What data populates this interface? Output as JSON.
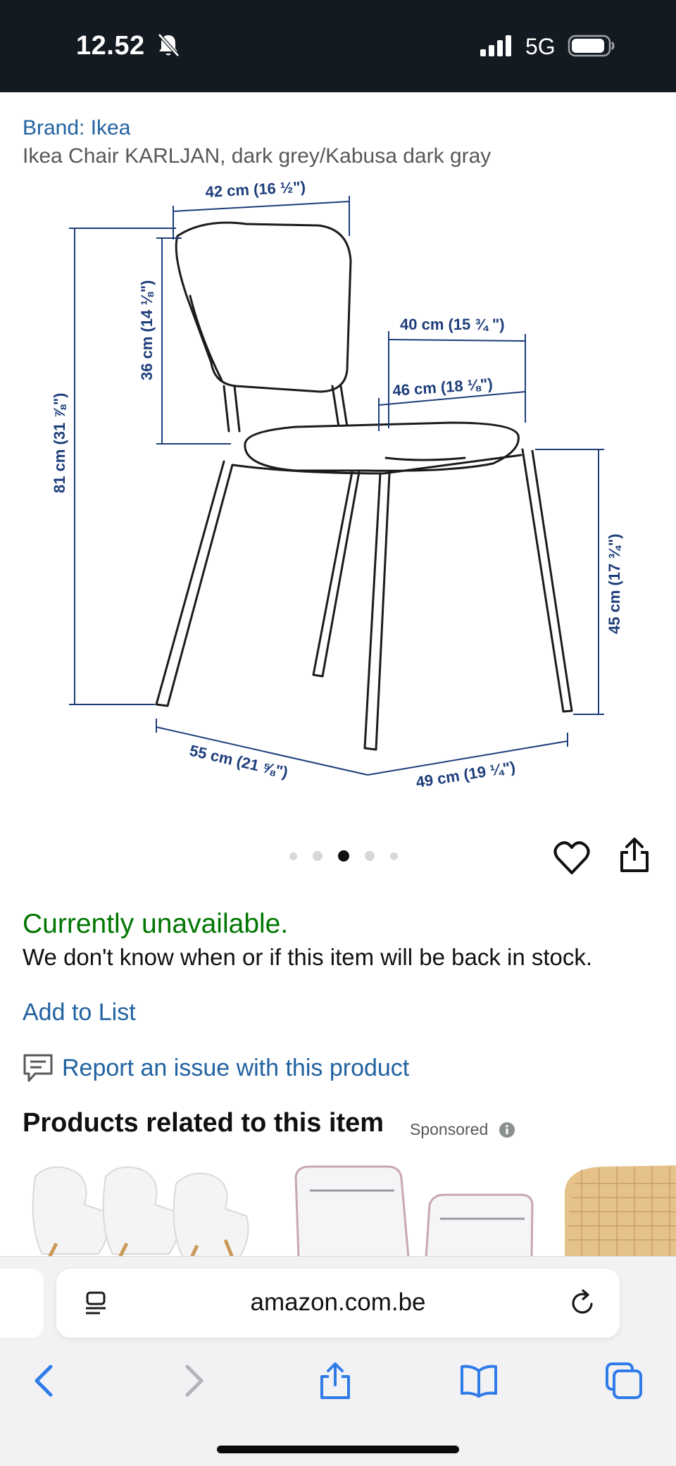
{
  "status_bar": {
    "time": "12.52",
    "network": "5G",
    "icons": [
      "bell-muted-icon",
      "signal-icon",
      "battery-icon"
    ]
  },
  "product": {
    "brand": "Brand: Ikea",
    "title": "Ikea Chair KARLJAN, dark grey/Kabusa dark gray"
  },
  "diagram": {
    "width_top": "42 cm (16 ½\")",
    "back_height": "36 cm (14 ⅛\")",
    "total_height": "81 cm (31 ⅞\")",
    "seat_width": "40 cm (15 ¾ \")",
    "seat_depth": "46 cm (18 ⅛\")",
    "seat_height": "45 cm (17 ¾\")",
    "depth": "55 cm (21 ⅝\")",
    "width": "49 cm (19 ¼\")"
  },
  "carousel": {
    "count": 5,
    "active_index": 2
  },
  "availability": {
    "status": "Currently unavailable.",
    "note": "We don't know when or if this item will be back in stock."
  },
  "actions": {
    "add_to_list": "Add to List",
    "report": "Report an issue with this product"
  },
  "related": {
    "heading": "Products related to this item",
    "sponsored": "Sponsored"
  },
  "browser": {
    "url": "amazon.com.be"
  },
  "colors": {
    "status_bar": "#131a22",
    "link": "#2162a1",
    "available": "#007600",
    "diagram_blue": "#1d3d7a"
  }
}
